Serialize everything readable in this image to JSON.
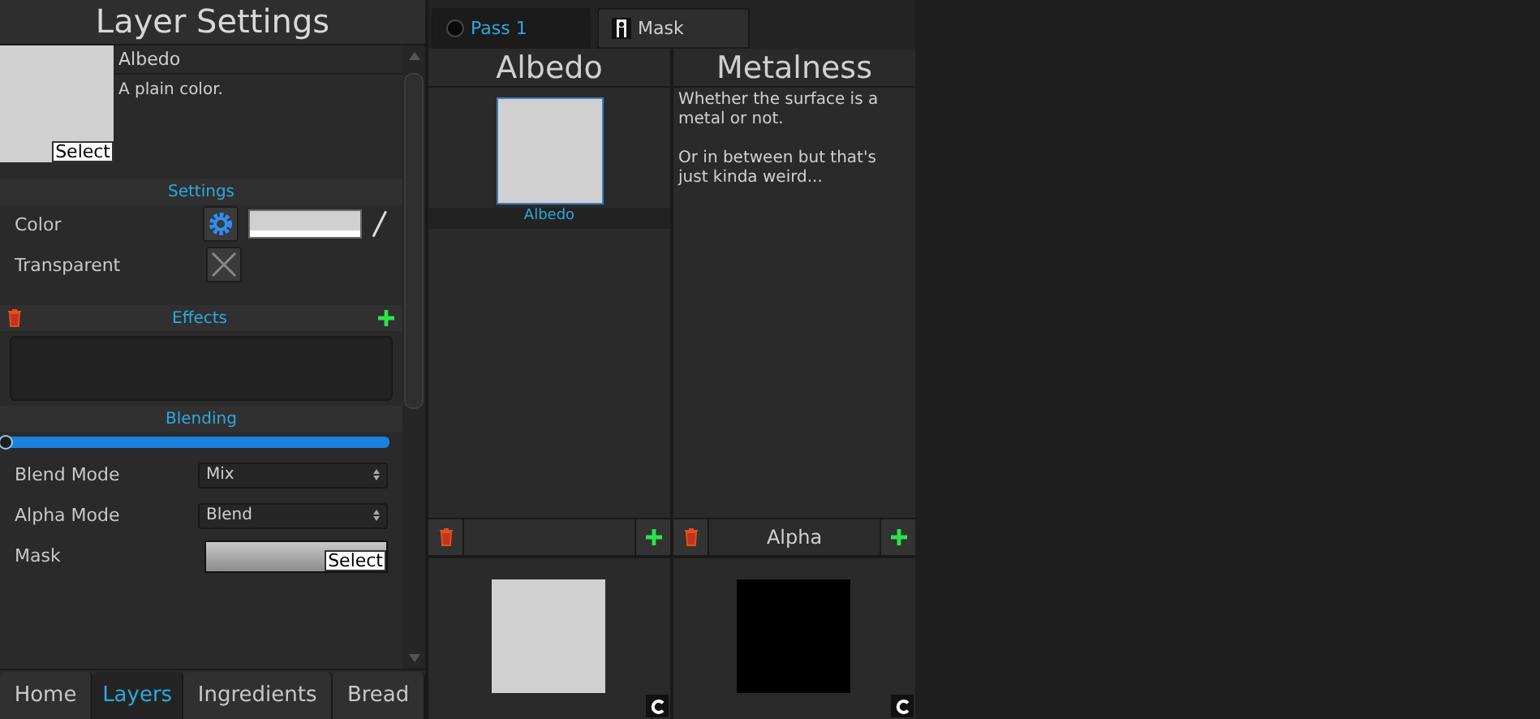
{
  "panel": {
    "title": "Layer Settings"
  },
  "layer": {
    "name": "Albedo",
    "description": "A plain color.",
    "select_label": "Select"
  },
  "settings": {
    "header": "Settings",
    "color_label": "Color",
    "transparent_label": "Transparent"
  },
  "effects": {
    "header": "Effects"
  },
  "blending": {
    "header": "Blending",
    "level": 0,
    "fields": [
      {
        "label": "Blend Mode",
        "value": "Mix",
        "kind": "dropdown"
      },
      {
        "label": "Alpha Mode",
        "value": "Blend",
        "kind": "dropdown"
      },
      {
        "label": "Mask",
        "value": "Select",
        "kind": "texture"
      }
    ]
  },
  "bottom_tabs": [
    {
      "label": "Home",
      "selected": false
    },
    {
      "label": "Layers",
      "selected": true
    },
    {
      "label": "Ingredients",
      "selected": false
    },
    {
      "label": "Bread",
      "selected": false
    }
  ],
  "pass_tabs": [
    {
      "label": "Pass 1",
      "selected": true,
      "kind": "sphere"
    },
    {
      "label": "Mask",
      "selected": false,
      "kind": "mask"
    }
  ],
  "columns": [
    {
      "title": "Albedo",
      "layers": [
        {
          "label": "Albedo",
          "selected": true
        }
      ],
      "color": "#d0d0d0"
    },
    {
      "title": "Metalness",
      "description": [
        "Whether the surface is a metal or not.",
        "Or in between but that's just kinda weird..."
      ],
      "footer_label": "Alpha",
      "color": "#000000"
    }
  ]
}
